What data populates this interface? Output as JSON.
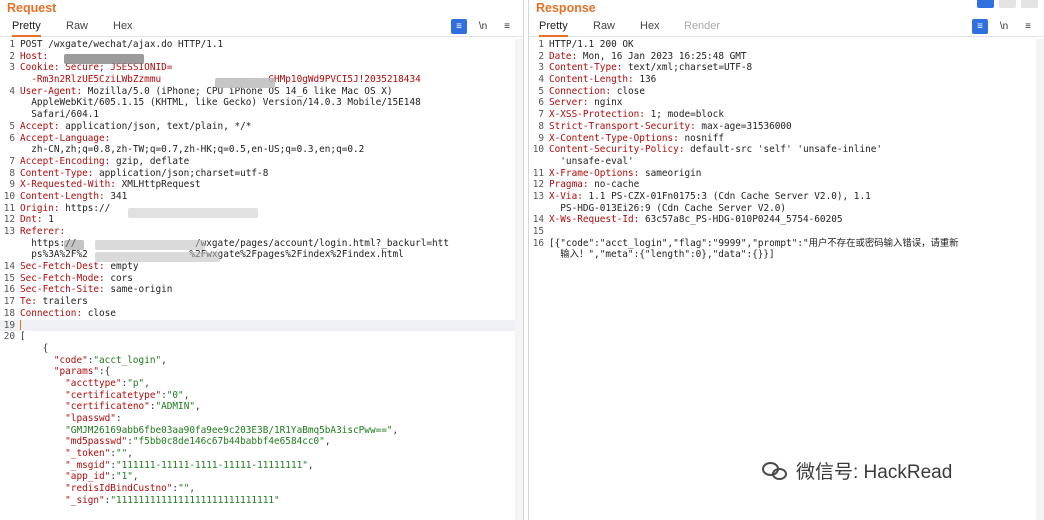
{
  "request": {
    "title": "Request",
    "tabs": [
      "Pretty",
      "Raw",
      "Hex"
    ],
    "lines": [
      {
        "n": "1",
        "parts": [
          {
            "t": "v",
            "s": "POST /wxgate/wechat/ajax.do HTTP/1.1"
          }
        ]
      },
      {
        "n": "2",
        "parts": [
          {
            "t": "k",
            "s": "Host:"
          }
        ]
      },
      {
        "n": "3",
        "parts": [
          {
            "t": "k",
            "s": "Cookie: Secure; JSESSIONID="
          }
        ]
      },
      {
        "n": "",
        "parts": [
          {
            "t": "k",
            "s": "  -Rm3n2RlzUE5CziLWbZzmmu                   GHMp10gWd9PVCI5J!2035218434"
          }
        ]
      },
      {
        "n": "4",
        "parts": [
          {
            "t": "k",
            "s": "User-Agent:"
          },
          {
            "t": "v",
            "s": " Mozilla/5.0 (iPhone; CPU iPhone OS 14_6 like Mac OS X)"
          }
        ]
      },
      {
        "n": "",
        "parts": [
          {
            "t": "v",
            "s": "  AppleWebKit/605.1.15 (KHTML, like Gecko) Version/14.0.3 Mobile/15E148"
          }
        ]
      },
      {
        "n": "",
        "parts": [
          {
            "t": "v",
            "s": "  Safari/604.1"
          }
        ]
      },
      {
        "n": "5",
        "parts": [
          {
            "t": "k",
            "s": "Accept:"
          },
          {
            "t": "v",
            "s": " application/json, text/plain, */*"
          }
        ]
      },
      {
        "n": "6",
        "parts": [
          {
            "t": "k",
            "s": "Accept-Language:"
          }
        ]
      },
      {
        "n": "",
        "parts": [
          {
            "t": "v",
            "s": "  zh-CN,zh;q=0.8,zh-TW;q=0.7,zh-HK;q=0.5,en-US;q=0.3,en;q=0.2"
          }
        ]
      },
      {
        "n": "7",
        "parts": [
          {
            "t": "k",
            "s": "Accept-Encoding:"
          },
          {
            "t": "v",
            "s": " gzip, deflate"
          }
        ]
      },
      {
        "n": "8",
        "parts": [
          {
            "t": "k",
            "s": "Content-Type:"
          },
          {
            "t": "v",
            "s": " application/json;charset=utf-8"
          }
        ]
      },
      {
        "n": "9",
        "parts": [
          {
            "t": "k",
            "s": "X-Requested-With:"
          },
          {
            "t": "v",
            "s": " XMLHttpRequest"
          }
        ]
      },
      {
        "n": "10",
        "parts": [
          {
            "t": "k",
            "s": "Content-Length:"
          },
          {
            "t": "v",
            "s": " 341"
          }
        ]
      },
      {
        "n": "11",
        "parts": [
          {
            "t": "k",
            "s": "Origin:"
          },
          {
            "t": "v",
            "s": " https://"
          }
        ]
      },
      {
        "n": "12",
        "parts": [
          {
            "t": "k",
            "s": "Dnt:"
          },
          {
            "t": "v",
            "s": " 1"
          }
        ]
      },
      {
        "n": "13",
        "parts": [
          {
            "t": "k",
            "s": "Referer:"
          }
        ]
      },
      {
        "n": "",
        "parts": [
          {
            "t": "v",
            "s": "  https://                     /wxgate/pages/account/login.html?_backurl=htt"
          }
        ]
      },
      {
        "n": "",
        "parts": [
          {
            "t": "v",
            "s": "  ps%3A%2F%2                  %2Fwxgate%2Fpages%2Findex%2Findex.html"
          }
        ]
      },
      {
        "n": "14",
        "parts": [
          {
            "t": "k",
            "s": "Sec-Fetch-Dest:"
          },
          {
            "t": "v",
            "s": " empty"
          }
        ]
      },
      {
        "n": "15",
        "parts": [
          {
            "t": "k",
            "s": "Sec-Fetch-Mode:"
          },
          {
            "t": "v",
            "s": " cors"
          }
        ]
      },
      {
        "n": "16",
        "parts": [
          {
            "t": "k",
            "s": "Sec-Fetch-Site:"
          },
          {
            "t": "v",
            "s": " same-origin"
          }
        ]
      },
      {
        "n": "17",
        "parts": [
          {
            "t": "k",
            "s": "Te:"
          },
          {
            "t": "v",
            "s": " trailers"
          }
        ]
      },
      {
        "n": "18",
        "parts": [
          {
            "t": "k",
            "s": "Connection:"
          },
          {
            "t": "v",
            "s": " close"
          }
        ]
      },
      {
        "n": "19",
        "parts": [],
        "cur": true
      },
      {
        "n": "20",
        "parts": [
          {
            "t": "p",
            "s": "["
          }
        ]
      },
      {
        "n": "",
        "parts": [
          {
            "t": "p",
            "s": "    {"
          }
        ]
      },
      {
        "n": "",
        "parts": [
          {
            "t": "k",
            "s": "      \"code\""
          },
          {
            "t": "p",
            "s": ":"
          },
          {
            "t": "s",
            "s": "\"acct_login\""
          },
          {
            "t": "p",
            "s": ","
          }
        ]
      },
      {
        "n": "",
        "parts": [
          {
            "t": "k",
            "s": "      \"params\""
          },
          {
            "t": "p",
            "s": ":{"
          }
        ]
      },
      {
        "n": "",
        "parts": [
          {
            "t": "k",
            "s": "        \"accttype\""
          },
          {
            "t": "p",
            "s": ":"
          },
          {
            "t": "s",
            "s": "\"p\""
          },
          {
            "t": "p",
            "s": ","
          }
        ]
      },
      {
        "n": "",
        "parts": [
          {
            "t": "k",
            "s": "        \"certificatetype\""
          },
          {
            "t": "p",
            "s": ":"
          },
          {
            "t": "s",
            "s": "\"0\""
          },
          {
            "t": "p",
            "s": ","
          }
        ]
      },
      {
        "n": "",
        "parts": [
          {
            "t": "k",
            "s": "        \"certificateno\""
          },
          {
            "t": "p",
            "s": ":"
          },
          {
            "t": "s",
            "s": "\"ADMIN\""
          },
          {
            "t": "p",
            "s": ","
          }
        ]
      },
      {
        "n": "",
        "parts": [
          {
            "t": "k",
            "s": "        \"lpasswd\""
          },
          {
            "t": "p",
            "s": ":"
          }
        ]
      },
      {
        "n": "",
        "parts": [
          {
            "t": "s",
            "s": "        \"GMJM26169abb6fbe03aa90fa9ee9c203E3B/1R1YaBmq5bA3iscPww==\""
          },
          {
            "t": "p",
            "s": ","
          }
        ]
      },
      {
        "n": "",
        "parts": [
          {
            "t": "k",
            "s": "        \"md5passwd\""
          },
          {
            "t": "p",
            "s": ":"
          },
          {
            "t": "s",
            "s": "\"f5bb0c8de146c67b44babbf4e6584cc0\""
          },
          {
            "t": "p",
            "s": ","
          }
        ]
      },
      {
        "n": "",
        "parts": [
          {
            "t": "k",
            "s": "        \"_token\""
          },
          {
            "t": "p",
            "s": ":"
          },
          {
            "t": "s",
            "s": "\"\""
          },
          {
            "t": "p",
            "s": ","
          }
        ]
      },
      {
        "n": "",
        "parts": [
          {
            "t": "k",
            "s": "        \"_msgid\""
          },
          {
            "t": "p",
            "s": ":"
          },
          {
            "t": "s",
            "s": "\"111111-11111-1111-11111-11111111\""
          },
          {
            "t": "p",
            "s": ","
          }
        ]
      },
      {
        "n": "",
        "parts": [
          {
            "t": "k",
            "s": "        \"app_id\""
          },
          {
            "t": "p",
            "s": ":"
          },
          {
            "t": "s",
            "s": "\"1\""
          },
          {
            "t": "p",
            "s": ","
          }
        ]
      },
      {
        "n": "",
        "parts": [
          {
            "t": "k",
            "s": "        \"redisIdBindCustno\""
          },
          {
            "t": "p",
            "s": ":"
          },
          {
            "t": "s",
            "s": "\"\""
          },
          {
            "t": "p",
            "s": ","
          }
        ]
      },
      {
        "n": "",
        "parts": [
          {
            "t": "k",
            "s": "        \"_sign\""
          },
          {
            "t": "p",
            "s": ":"
          },
          {
            "t": "s",
            "s": "\"1111111111111111111111111111\""
          }
        ]
      }
    ]
  },
  "response": {
    "title": "Response",
    "tabs": [
      "Pretty",
      "Raw",
      "Hex",
      "Render"
    ],
    "lines": [
      {
        "n": "1",
        "parts": [
          {
            "t": "v",
            "s": "HTTP/1.1 200 OK"
          }
        ]
      },
      {
        "n": "2",
        "parts": [
          {
            "t": "k",
            "s": "Date:"
          },
          {
            "t": "v",
            "s": " Mon, 16 Jan 2023 16:25:48 GMT"
          }
        ]
      },
      {
        "n": "3",
        "parts": [
          {
            "t": "k",
            "s": "Content-Type:"
          },
          {
            "t": "v",
            "s": " text/xml;charset=UTF-8"
          }
        ]
      },
      {
        "n": "4",
        "parts": [
          {
            "t": "k",
            "s": "Content-Length:"
          },
          {
            "t": "v",
            "s": " 136"
          }
        ]
      },
      {
        "n": "5",
        "parts": [
          {
            "t": "k",
            "s": "Connection:"
          },
          {
            "t": "v",
            "s": " close"
          }
        ]
      },
      {
        "n": "6",
        "parts": [
          {
            "t": "k",
            "s": "Server:"
          },
          {
            "t": "v",
            "s": " nginx"
          }
        ]
      },
      {
        "n": "7",
        "parts": [
          {
            "t": "k",
            "s": "X-XSS-Protection:"
          },
          {
            "t": "v",
            "s": " 1; mode=block"
          }
        ]
      },
      {
        "n": "8",
        "parts": [
          {
            "t": "k",
            "s": "Strict-Transport-Security:"
          },
          {
            "t": "v",
            "s": " max-age=31536000"
          }
        ]
      },
      {
        "n": "9",
        "parts": [
          {
            "t": "k",
            "s": "X-Content-Type-Options:"
          },
          {
            "t": "v",
            "s": " nosniff"
          }
        ]
      },
      {
        "n": "10",
        "parts": [
          {
            "t": "k",
            "s": "Content-Security-Policy:"
          },
          {
            "t": "v",
            "s": " default-src 'self' 'unsafe-inline'"
          }
        ]
      },
      {
        "n": "",
        "parts": [
          {
            "t": "v",
            "s": "  'unsafe-eval'"
          }
        ]
      },
      {
        "n": "11",
        "parts": [
          {
            "t": "k",
            "s": "X-Frame-Options:"
          },
          {
            "t": "v",
            "s": " sameorigin"
          }
        ]
      },
      {
        "n": "12",
        "parts": [
          {
            "t": "k",
            "s": "Pragma:"
          },
          {
            "t": "v",
            "s": " no-cache"
          }
        ]
      },
      {
        "n": "13",
        "parts": [
          {
            "t": "k",
            "s": "X-Via:"
          },
          {
            "t": "v",
            "s": " 1.1 PS-CZX-01Fn0175:3 (Cdn Cache Server V2.0), 1.1"
          }
        ]
      },
      {
        "n": "",
        "parts": [
          {
            "t": "v",
            "s": "  PS-HDG-013Ei26:9 (Cdn Cache Server V2.0)"
          }
        ]
      },
      {
        "n": "14",
        "parts": [
          {
            "t": "k",
            "s": "X-Ws-Request-Id:"
          },
          {
            "t": "v",
            "s": " 63c57a8c_PS-HDG-010P0244_5754-60205"
          }
        ]
      },
      {
        "n": "15",
        "parts": []
      },
      {
        "n": "16",
        "parts": [
          {
            "t": "v",
            "s": "[{\"code\":\"acct_login\",\"flag\":\"9999\",\"prompt\":\"用户不存在或密码输入错误，请重新"
          }
        ]
      },
      {
        "n": "",
        "parts": [
          {
            "t": "v",
            "s": "  输入！\",\"meta\":{\"length\":0},\"data\":{}}]"
          }
        ]
      }
    ]
  },
  "watermark": {
    "text": "微信号: HackRead"
  },
  "icons": {
    "pretty_print": "wrap-lines-icon",
    "newline": "\\n",
    "menu": "menu-icon"
  }
}
